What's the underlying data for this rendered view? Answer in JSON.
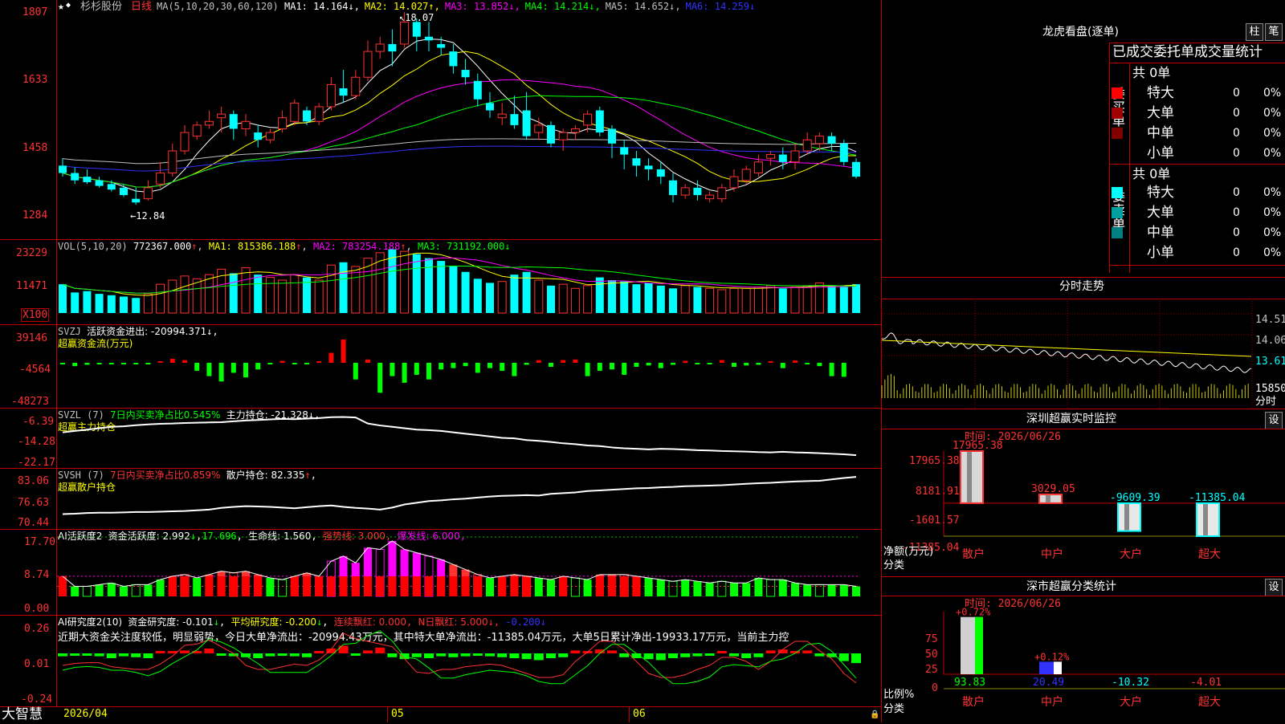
{
  "stock": {
    "name": "杉杉股份",
    "period": "日线",
    "ma_params": "MA(5,10,20,30,60,120)"
  },
  "main": {
    "ma_values": [
      {
        "label": "MA1: 14.164",
        "arrow": "↓",
        "color": "#ffffff"
      },
      {
        "label": "MA2: 14.027",
        "arrow": "↑",
        "color": "#ffff00"
      },
      {
        "label": "MA3: 13.852",
        "arrow": "↓",
        "color": "#ff00ff"
      },
      {
        "label": "MA4: 14.214",
        "arrow": "↓",
        "color": "#00ff00"
      },
      {
        "label": "MA5: 14.652",
        "arrow": "↓",
        "color": "#c0c0c0"
      },
      {
        "label": "MA6: 14.259",
        "arrow": "↓",
        "color": "#3232ff"
      }
    ],
    "yticks": [
      "1807",
      "1633",
      "1458",
      "1284"
    ],
    "high_label": "18.07",
    "low_label": "12.84"
  },
  "vol": {
    "title": "VOL(5,10,20)",
    "value": "772367.000",
    "ma1": "MA1: 815386.188",
    "ma2": "MA2: 783254.188",
    "ma3": "MA3: 731192.000",
    "yticks": [
      "23229",
      "11471"
    ],
    "unit": "X100"
  },
  "svzj": {
    "title": "SVZJ",
    "label": "活跃资金进出: -20994.371",
    "sub": "超赢资金流(万元)",
    "yticks": [
      "39146",
      "-4564",
      "-48273"
    ]
  },
  "svzl": {
    "title": "SVZL (7)",
    "label1": "7日内买卖净占比0.545%",
    "label2": "主力持仓: -21.328",
    "sub": "超赢主力持仓",
    "yticks": [
      "-6.39",
      "-14.28",
      "-22.17"
    ]
  },
  "svsh": {
    "title": "SVSH (7)",
    "label1": "7日内买卖净占比0.859%",
    "label2": "散户持仓: 82.335",
    "sub": "超赢散户持仓",
    "yticks": [
      "83.06",
      "76.63",
      "70.44"
    ]
  },
  "ai1": {
    "title": "AI活跃度2",
    "l1": "资金活跃度: 2.992",
    "l2": "17.696",
    "l3": "生命线: 1.560",
    "l4": "强势线: 3.000",
    "l5": "爆发线: 6.000",
    "yticks": [
      "17.70",
      "8.74",
      "0.00"
    ]
  },
  "ai2": {
    "title": "AI研究度2(10)",
    "l1": "资金研究度: -0.101",
    "l2": "平均研究度: -0.200",
    "l3": "连续飘红: 0.000",
    "l4": "N日飘红: 5.000",
    "l5": "-0.200",
    "comment": "近期大资金关注度较低，明显弱势，今日大单净流出：-20994.43万元，其中特大单净流出：-11385.04万元，大单5日累计净出-19933.17万元，当前主力控",
    "yticks": [
      "0.26",
      "0.01",
      "-0.24"
    ]
  },
  "xaxis": {
    "date": "2026/04",
    "m5": "05",
    "m6": "06"
  },
  "brand": "大智慧",
  "right": {
    "dragon_title": "龙虎看盘(逐单)",
    "btn_bar": "柱",
    "btn_pen": "笔",
    "header": "已成交委托单成交量统计",
    "buy": {
      "side": "委买单",
      "total": "共 0单",
      "rows": [
        {
          "name": "特大",
          "v": "0",
          "p": "0%",
          "color": "#ff0000"
        },
        {
          "name": "大单",
          "v": "0",
          "p": "0%",
          "color": "#a00000"
        },
        {
          "name": "中单",
          "v": "0",
          "p": "0%",
          "color": "#800000"
        },
        {
          "name": "小单",
          "v": "0",
          "p": "0%",
          "color": "#000000"
        }
      ]
    },
    "sell": {
      "side": "委卖单",
      "total": "共 0单",
      "rows": [
        {
          "name": "特大",
          "v": "0",
          "p": "0%",
          "color": "#00ffff"
        },
        {
          "name": "大单",
          "v": "0",
          "p": "0%",
          "color": "#00a0a0"
        },
        {
          "name": "中单",
          "v": "0",
          "p": "0%",
          "color": "#008080"
        },
        {
          "name": "小单",
          "v": "0",
          "p": "0%",
          "color": "#000000"
        }
      ]
    },
    "intraday": {
      "title": "分时走势",
      "ticks": [
        "14.51",
        "14.06",
        "13.61",
        "15850"
      ],
      "time_label": "分时"
    },
    "sz_monitor": {
      "title": "深圳超赢实时监控",
      "btn": "设",
      "time": "时间: 2026/06/26",
      "yticks": [
        "17965.38",
        "8181.91",
        "-1601.57",
        "-11385.04"
      ],
      "ylabel": "净额(万元)",
      "xlabel": "分类",
      "bars": [
        {
          "cat": "散户",
          "v": 17965.38,
          "label": "17965.38"
        },
        {
          "cat": "中户",
          "v": 3029.05,
          "label": "3029.05"
        },
        {
          "cat": "大户",
          "v": -9609.39,
          "label": "-9609.39"
        },
        {
          "cat": "超大",
          "v": -11385.04,
          "label": "-11385.04"
        }
      ]
    },
    "sz_class": {
      "title": "深市超赢分类统计",
      "btn": "设",
      "time": "时间: 2026/06/26",
      "yticks": [
        "75",
        "50",
        "25",
        "0"
      ],
      "ylabel": "比例%",
      "xlabel": "分类",
      "bars": [
        {
          "cat": "散户",
          "v": 93.83,
          "top": "+0.72%",
          "bottom": "93.83"
        },
        {
          "cat": "中户",
          "v": 20.49,
          "top": "+0.12%",
          "bottom": "20.49"
        },
        {
          "cat": "大户",
          "v": -10.32,
          "top": "",
          "bottom": "-10.32"
        },
        {
          "cat": "超大",
          "v": -4.01,
          "top": "",
          "bottom": "-4.01"
        }
      ]
    }
  },
  "chart_data": [
    {
      "type": "candlestick",
      "title": "杉杉股份 日线",
      "ma": [
        "MA1",
        "MA2",
        "MA3",
        "MA4",
        "MA5",
        "MA6"
      ],
      "ohlc": [
        [
          13.9,
          14.1,
          13.7,
          13.6
        ],
        [
          13.7,
          13.85,
          13.5,
          13.4
        ],
        [
          13.6,
          13.8,
          13.45,
          13.4
        ],
        [
          13.5,
          13.6,
          13.35,
          13.3
        ],
        [
          13.4,
          13.5,
          13.25,
          13.2
        ],
        [
          13.3,
          13.4,
          13.1,
          13.05
        ],
        [
          13.0,
          13.3,
          12.9,
          12.84
        ],
        [
          13.0,
          13.5,
          13.3,
          12.95
        ],
        [
          13.4,
          14.0,
          13.7,
          13.3
        ],
        [
          13.7,
          14.5,
          14.3,
          13.6
        ],
        [
          14.3,
          15.0,
          14.8,
          14.2
        ],
        [
          14.7,
          15.1,
          15.0,
          14.6
        ],
        [
          15.0,
          15.4,
          15.1,
          14.9
        ],
        [
          15.2,
          15.5,
          15.3,
          14.8
        ],
        [
          15.3,
          15.4,
          14.9,
          14.6
        ],
        [
          14.9,
          15.3,
          15.1,
          14.7
        ],
        [
          14.8,
          15.0,
          14.6,
          14.4
        ],
        [
          14.6,
          14.9,
          14.8,
          14.5
        ],
        [
          14.9,
          15.4,
          15.2,
          14.8
        ],
        [
          15.1,
          15.7,
          15.6,
          15.0
        ],
        [
          15.4,
          15.5,
          15.1,
          15.0
        ],
        [
          15.1,
          15.6,
          15.5,
          15.0
        ],
        [
          15.5,
          16.3,
          16.1,
          15.4
        ],
        [
          16.0,
          16.5,
          15.8,
          15.6
        ],
        [
          15.8,
          16.5,
          16.3,
          15.7
        ],
        [
          16.3,
          17.3,
          17.0,
          16.2
        ],
        [
          17.0,
          17.4,
          17.2,
          16.8
        ],
        [
          17.2,
          17.6,
          17.0,
          16.6
        ],
        [
          17.2,
          18.07,
          17.8,
          17.1
        ],
        [
          17.8,
          17.9,
          17.4,
          17.0
        ],
        [
          17.4,
          17.8,
          17.3,
          17.0
        ],
        [
          17.2,
          17.4,
          17.1,
          16.9
        ],
        [
          17.0,
          17.2,
          16.6,
          16.4
        ],
        [
          16.5,
          16.8,
          16.3,
          16.1
        ],
        [
          16.2,
          16.4,
          15.7,
          15.5
        ],
        [
          15.6,
          15.9,
          15.4,
          15.2
        ],
        [
          15.2,
          15.6,
          15.3,
          15.0
        ],
        [
          15.3,
          15.8,
          15.0,
          14.9
        ],
        [
          15.4,
          15.9,
          14.7,
          14.6
        ],
        [
          14.8,
          15.2,
          15.0,
          14.6
        ],
        [
          15.0,
          15.1,
          14.5,
          14.4
        ],
        [
          14.6,
          14.9,
          14.8,
          14.3
        ],
        [
          14.8,
          15.0,
          14.9,
          14.6
        ],
        [
          15.0,
          15.4,
          15.3,
          14.8
        ],
        [
          15.4,
          15.5,
          14.8,
          14.7
        ],
        [
          14.9,
          15.0,
          14.5,
          14.1
        ],
        [
          14.4,
          14.6,
          14.2,
          13.8
        ],
        [
          14.1,
          14.3,
          13.9,
          13.6
        ],
        [
          13.9,
          14.1,
          13.8,
          13.5
        ],
        [
          13.8,
          14.0,
          13.6,
          13.4
        ],
        [
          13.5,
          13.7,
          13.1,
          12.9
        ],
        [
          13.1,
          13.4,
          13.3,
          13.0
        ],
        [
          13.3,
          13.5,
          13.1,
          12.95
        ],
        [
          13.0,
          13.2,
          13.1,
          12.9
        ],
        [
          13.0,
          13.4,
          13.3,
          12.9
        ],
        [
          13.3,
          13.8,
          13.6,
          13.2
        ],
        [
          13.5,
          13.9,
          13.8,
          13.4
        ],
        [
          13.7,
          14.2,
          14.0,
          13.6
        ],
        [
          14.1,
          14.3,
          14.2,
          13.9
        ],
        [
          14.2,
          14.4,
          14.0,
          13.8
        ],
        [
          14.0,
          14.5,
          14.3,
          13.8
        ],
        [
          14.3,
          14.8,
          14.6,
          14.2
        ],
        [
          14.5,
          14.8,
          14.7,
          14.3
        ],
        [
          14.7,
          14.8,
          14.5,
          14.3
        ],
        [
          14.5,
          14.6,
          14.0,
          13.9
        ],
        [
          14.0,
          14.1,
          13.6,
          13.55
        ]
      ]
    },
    {
      "type": "bar",
      "title": "VOL",
      "values": [
        10.5,
        7.5,
        8.0,
        7.0,
        6.5,
        6.0,
        5.5,
        7.0,
        10.5,
        12.0,
        13.5,
        12.5,
        14.0,
        16.0,
        14.5,
        16.5,
        14.0,
        13.0,
        12.0,
        14.0,
        13.0,
        12.0,
        17.5,
        18.5,
        17.0,
        20.0,
        22.0,
        23.229,
        22.5,
        21.5,
        20.0,
        19.0,
        17.0,
        15.0,
        12.5,
        11.0,
        11.5,
        14.0,
        15.0,
        12.0,
        10.0,
        10.5,
        9.0,
        10.0,
        13.0,
        12.0,
        11.5,
        10.5,
        11.0,
        10.0,
        9.0,
        10.0,
        9.5,
        9.0,
        8.5,
        9.0,
        9.0,
        9.5,
        10.0,
        9.0,
        9.5,
        10.0,
        11.0,
        10.0,
        9.5,
        10.5
      ]
    },
    {
      "type": "bar",
      "title": "超赢资金流(万元)",
      "values": [
        -2000,
        -5000,
        -3000,
        -1500,
        -1000,
        -2000,
        -800,
        -1500,
        2000,
        6000,
        4000,
        -12000,
        -20000,
        -28000,
        -15000,
        -22000,
        -10000,
        -1000,
        3000,
        -1000,
        -2000,
        1500,
        15000,
        35000,
        -25000,
        5000,
        -45000,
        -20000,
        -30000,
        -18000,
        -25000,
        -10000,
        -8000,
        -5000,
        -15000,
        -8000,
        -12000,
        -20000,
        -3000,
        4000,
        -6000,
        4000,
        5000,
        -20000,
        -12000,
        -10000,
        -18000,
        -6000,
        -4000,
        -8000,
        -3000,
        3000,
        -1000,
        -2000,
        4000,
        -6000,
        -4000,
        -3000,
        2500,
        -8000,
        3500,
        -2000,
        -5000,
        -20000,
        -20994.371
      ]
    },
    {
      "type": "line",
      "title": "超赢主力持仓",
      "values": [
        -13.0,
        -12.5,
        -12.0,
        -11.5,
        -11.0,
        -10.8,
        -10.4,
        -10.1,
        -9.9,
        -9.8,
        -9.6,
        -9.5,
        -9.4,
        -9.3,
        -9.0,
        -8.7,
        -8.5,
        -8.3,
        -8.1,
        -8.2,
        -8.0,
        -7.8,
        -7.5,
        -7.4,
        -7.6,
        -9.8,
        -10.5,
        -11.0,
        -11.5,
        -12.0,
        -12.2,
        -12.5,
        -13.0,
        -13.5,
        -14.0,
        -14.5,
        -15.0,
        -15.2,
        -15.8,
        -16.1,
        -16.5,
        -17.0,
        -17.3,
        -17.8,
        -18.0,
        -18.5,
        -18.8,
        -19.0,
        -19.2,
        -19.0,
        -19.1,
        -19.3,
        -19.5,
        -19.6,
        -19.8,
        -19.9,
        -20.0,
        -20.2,
        -20.3,
        -20.1,
        -20.3,
        -20.4,
        -20.6,
        -20.8,
        -21.0,
        -21.328
      ]
    },
    {
      "type": "line",
      "title": "超赢散户持仓",
      "values": [
        71.5,
        71.6,
        71.8,
        71.9,
        71.9,
        72.0,
        72.1,
        72.1,
        72.2,
        72.3,
        72.4,
        72.6,
        72.8,
        73.3,
        73.6,
        73.8,
        73.7,
        73.6,
        73.4,
        73.2,
        73.5,
        73.8,
        74.0,
        73.6,
        73.3,
        73.1,
        72.8,
        73.4,
        74.3,
        74.8,
        75.3,
        75.5,
        75.8,
        76.0,
        76.3,
        76.6,
        76.8,
        76.9,
        77.0,
        76.9,
        77.4,
        77.6,
        77.8,
        78.2,
        78.4,
        78.6,
        78.8,
        79.0,
        79.1,
        79.3,
        79.4,
        79.6,
        79.7,
        79.8,
        79.9,
        80.1,
        80.3,
        80.5,
        80.6,
        80.8,
        81.0,
        81.1,
        81.2,
        81.6,
        82.0,
        82.335
      ]
    },
    {
      "type": "bar",
      "title": "AI活跃度2",
      "values": [
        6.0,
        3.0,
        3.0,
        3.5,
        4.0,
        3.0,
        3.5,
        3.5,
        5.0,
        6.0,
        6.5,
        5.5,
        6.5,
        7.5,
        7.0,
        7.5,
        6.5,
        5.5,
        5.0,
        6.0,
        7.0,
        6.0,
        10.5,
        12.0,
        10.0,
        14.5,
        14.0,
        16.5,
        14.0,
        13.0,
        12.0,
        11.0,
        9.5,
        8.0,
        6.5,
        5.5,
        6.0,
        6.5,
        6.0,
        5.5,
        5.0,
        6.0,
        5.5,
        5.0,
        6.5,
        6.5,
        6.5,
        6.0,
        5.5,
        5.0,
        4.5,
        5.0,
        4.5,
        4.0,
        4.5,
        4.0,
        4.0,
        5.5,
        5.0,
        5.0,
        4.0,
        3.5,
        3.5,
        3.5,
        3.5,
        2.992
      ]
    },
    {
      "type": "bar",
      "title": "AI研究度2(10)",
      "values": [
        -0.03,
        -0.02,
        -0.02,
        -0.03,
        -0.05,
        -0.03,
        -0.04,
        -0.05,
        0.01,
        0.02,
        0.03,
        0.02,
        0.05,
        -0.02,
        -0.03,
        -0.04,
        -0.05,
        -0.03,
        -0.02,
        -0.03,
        -0.04,
        0.02,
        0.05,
        0.08,
        -0.02,
        0.03,
        0.06,
        -0.04,
        -0.06,
        -0.04,
        -0.05,
        -0.03,
        -0.04,
        -0.03,
        -0.02,
        -0.03,
        -0.04,
        -0.05,
        -0.06,
        -0.07,
        -0.05,
        -0.04,
        0.03,
        0.02,
        0.04,
        0.03,
        -0.04,
        -0.05,
        -0.06,
        -0.07,
        -0.05,
        -0.04,
        -0.03,
        -0.02,
        0.02,
        -0.03,
        -0.05,
        -0.04,
        0.03,
        0.04,
        0.02,
        0.03,
        -0.03,
        -0.04,
        -0.08,
        -0.101
      ]
    }
  ]
}
